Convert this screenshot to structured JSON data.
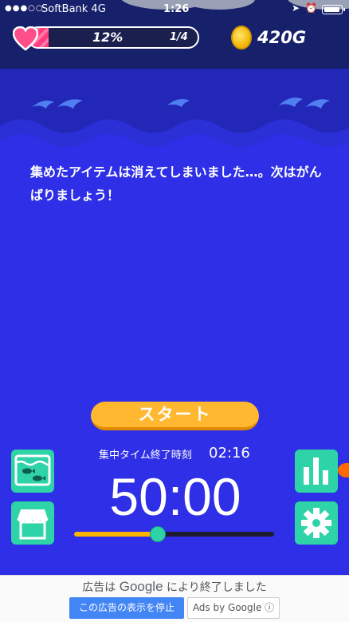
{
  "status_bar": {
    "signal": "●●●○○",
    "carrier": "SoftBank  4G",
    "time": "1:26",
    "location_icon": "location-arrow-icon",
    "alarm_icon": "alarm-clock-icon",
    "battery_icon": "battery-icon"
  },
  "hud": {
    "hp_percent_label": "12%",
    "hp_fraction": 0.12,
    "hp_count": "1/4",
    "gold": "420G",
    "heart_icon": "heart-icon",
    "coin_icon": "coin-icon"
  },
  "message": "集めたアイテムは消えてしまいました…。次はがんばりましょう！",
  "start_button": "スタート",
  "focus": {
    "end_time_label": "集中タイム終了時刻",
    "end_time": "02:16",
    "timer": "50:00",
    "slider_fraction": 0.42
  },
  "side_buttons": {
    "aquarium": "aquarium-icon",
    "shop": "shop-icon",
    "stats": "bar-chart-icon",
    "settings": "gear-icon"
  },
  "ad": {
    "message_prefix": "広告は",
    "brand": "Google",
    "message_suffix": "により終了しました",
    "stop_button": "この広告の表示を停止",
    "ads_by": "Ads by Google ⓘ"
  },
  "colors": {
    "background": "#2e2fe6",
    "night": "#17206a",
    "accent_green": "#2fd3a8",
    "start_orange": "#ffb830",
    "hp_pink": "#ff3d7f"
  }
}
